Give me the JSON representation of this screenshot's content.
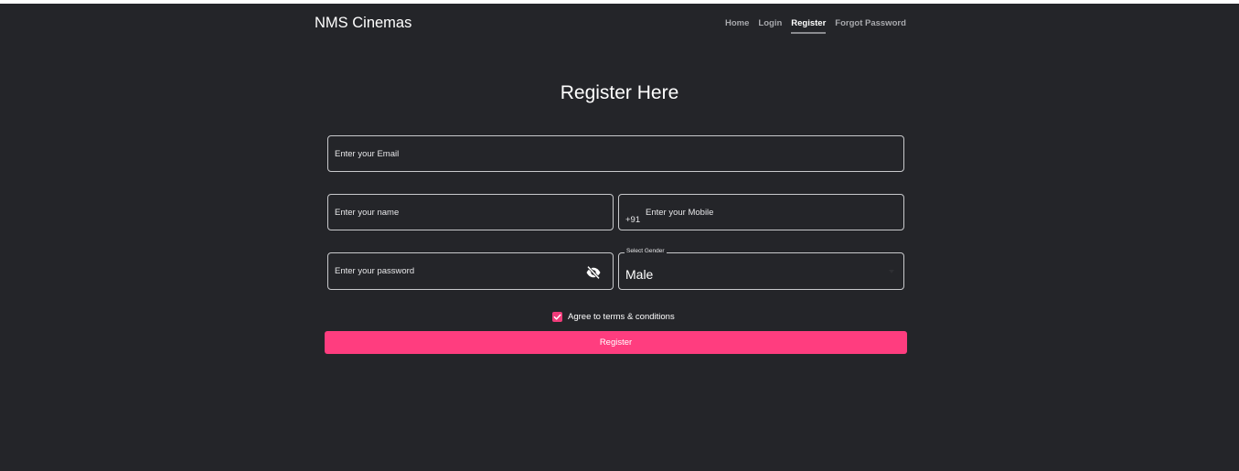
{
  "header": {
    "brand": "NMS Cinemas",
    "nav": [
      {
        "label": "Home",
        "active": false
      },
      {
        "label": "Login",
        "active": false
      },
      {
        "label": "Register",
        "active": true
      },
      {
        "label": "Forgot Password",
        "active": false
      }
    ]
  },
  "form": {
    "title": "Register Here",
    "email": {
      "placeholder": "Enter your Email",
      "value": ""
    },
    "name": {
      "placeholder": "Enter your name",
      "value": ""
    },
    "mobile": {
      "prefix": "+91",
      "placeholder": "Enter your Mobile",
      "value": ""
    },
    "password": {
      "placeholder": "Enter your password",
      "value": "",
      "toggle_icon": "eye-off-icon"
    },
    "gender": {
      "label": "Select Gender",
      "value": "Male"
    },
    "terms": {
      "label": "Agree to terms & conditions",
      "checked": true
    },
    "submit_label": "Register"
  },
  "colors": {
    "background": "#242529",
    "accent": "#ff3d7f",
    "field_border": "#c8c9cc",
    "text": "#ffffff"
  }
}
